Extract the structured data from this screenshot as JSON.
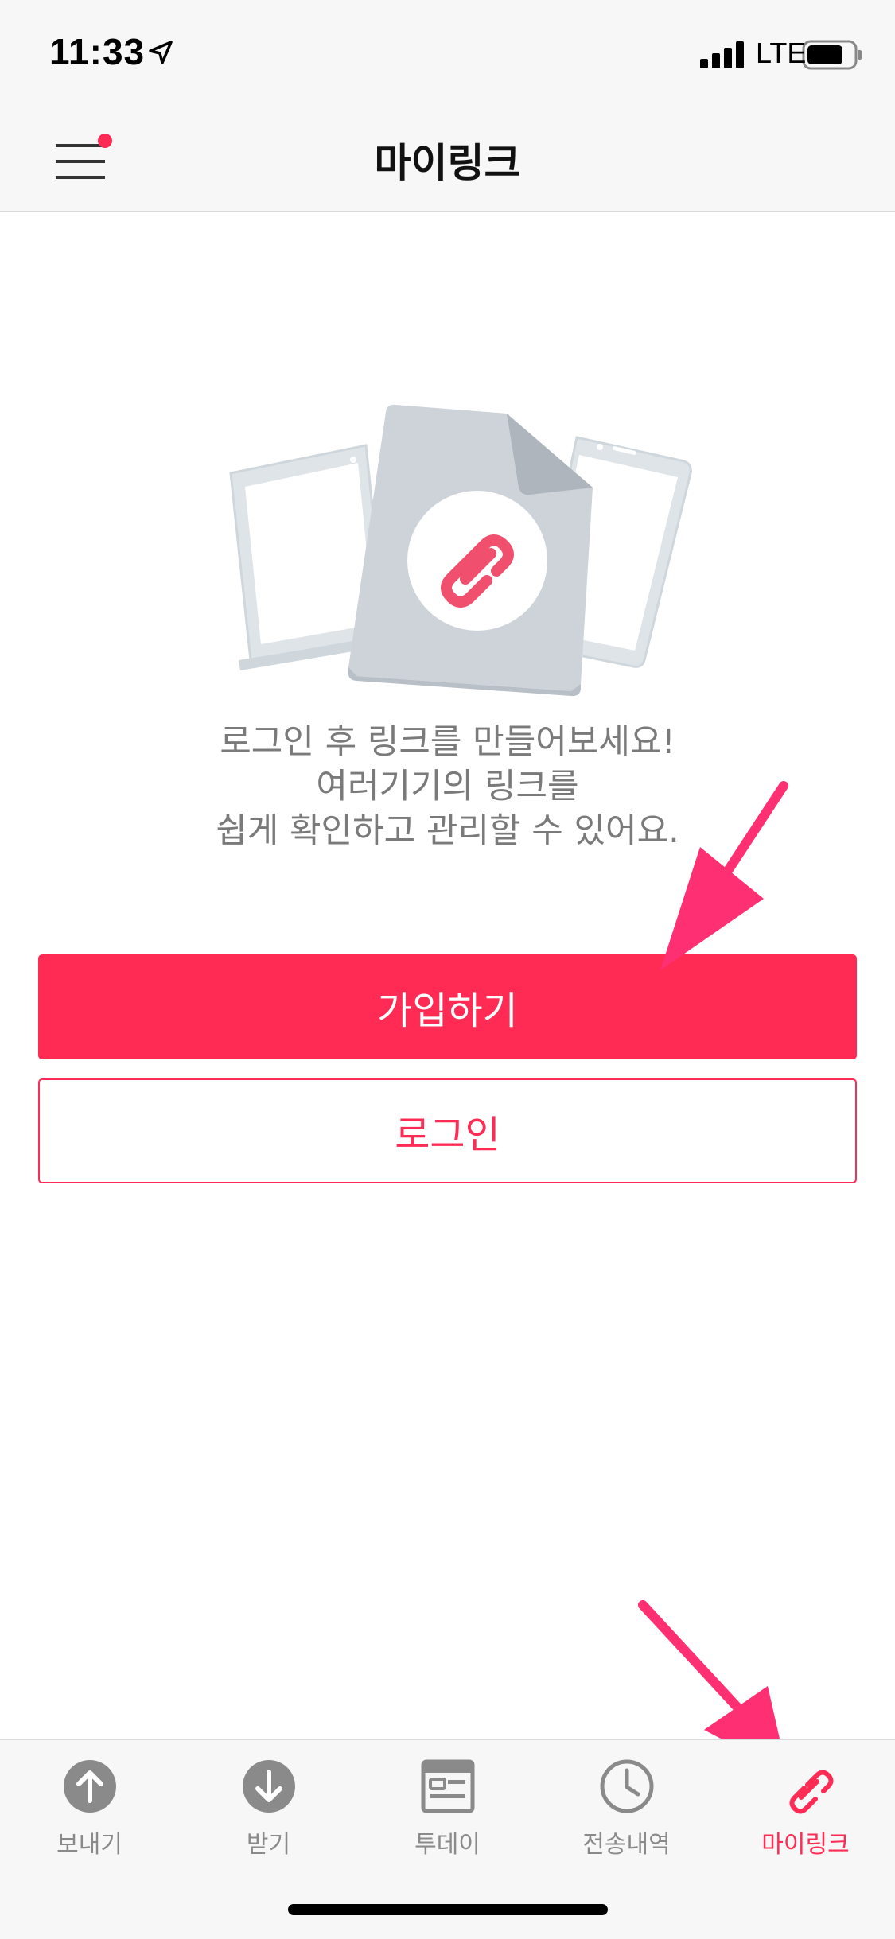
{
  "status_bar": {
    "time": "11:33",
    "network": "LTE"
  },
  "header": {
    "title": "마이링크"
  },
  "empty_state": {
    "lines": [
      "로그인 후 링크를 만들어보세요!",
      "여러기기의 링크를",
      "쉽게 확인하고 관리할 수 있어요."
    ]
  },
  "buttons": {
    "signup": "가입하기",
    "login": "로그인"
  },
  "tab_bar": {
    "items": [
      {
        "label": "보내기",
        "icon": "upload-icon"
      },
      {
        "label": "받기",
        "icon": "download-icon"
      },
      {
        "label": "투데이",
        "icon": "today-icon"
      },
      {
        "label": "전송내역",
        "icon": "clock-icon"
      },
      {
        "label": "마이링크",
        "icon": "link-icon",
        "active": true
      }
    ]
  },
  "colors": {
    "accent": "#ff2b55",
    "annotation": "#ff2f73",
    "tab_inactive": "#8a8a8a"
  }
}
